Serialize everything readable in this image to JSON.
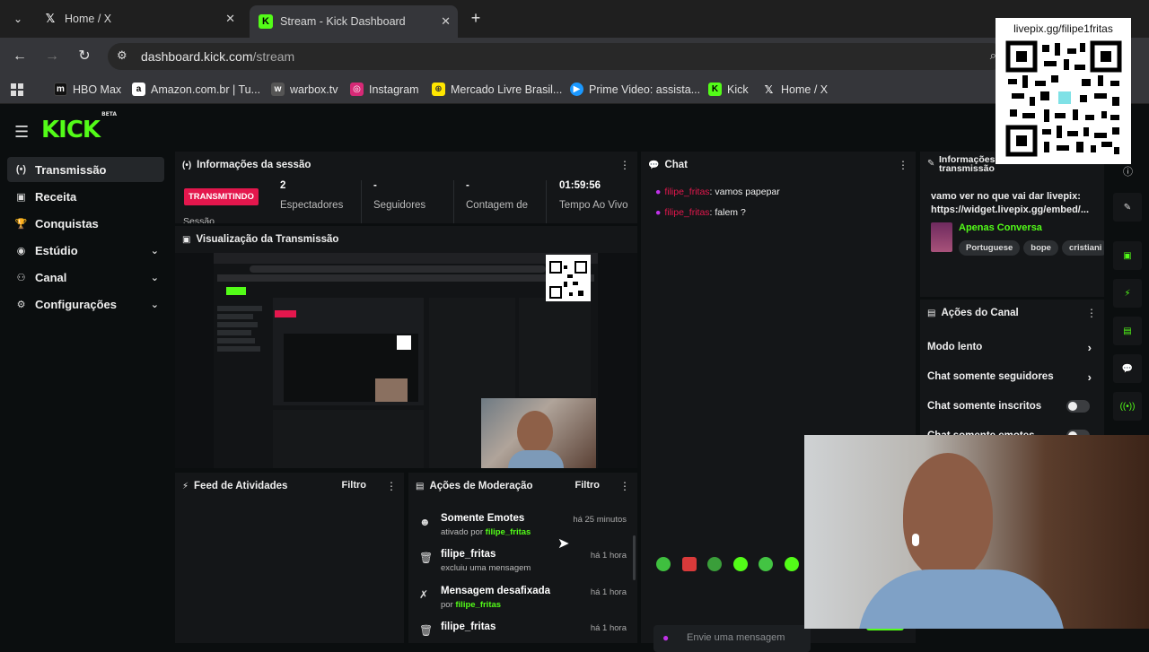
{
  "browser": {
    "tabs": [
      {
        "title": "Home / X",
        "favicon": "x-logo-icon"
      },
      {
        "title": "Stream - Kick Dashboard",
        "favicon": "kick-logo-icon"
      }
    ],
    "new_tab": "+",
    "url_host": "dashboard.kick.com",
    "url_path": "/stream",
    "bookmarks": [
      {
        "label": "HBO Max",
        "icon": "m",
        "color": "#111111"
      },
      {
        "label": "Amazon.com.br | Tu...",
        "icon": "a",
        "color": "#ffffff"
      },
      {
        "label": "warbox.tv",
        "icon": "w",
        "color": "#555555"
      },
      {
        "label": "Instagram",
        "icon": "ig",
        "color": "#d62976"
      },
      {
        "label": "Mercado Livre Brasil...",
        "icon": "ml",
        "color": "#ffe600"
      },
      {
        "label": "Prime Video: assista...",
        "icon": "pv",
        "color": "#1a98ff"
      },
      {
        "label": "Kick",
        "icon": "k",
        "color": "#53fc18"
      },
      {
        "label": "Home / X",
        "icon": "x",
        "color": "#000000"
      }
    ]
  },
  "qr": {
    "caption": "livepix.gg/filipe1fritas"
  },
  "kick": {
    "logo": "KICK",
    "logo_badge": "BETA",
    "sidebar": [
      {
        "label": "Transmissão",
        "icon": "broadcast-icon",
        "active": true
      },
      {
        "label": "Receita",
        "icon": "revenue-icon"
      },
      {
        "label": "Conquistas",
        "icon": "achievements-icon"
      },
      {
        "label": "Estúdio",
        "icon": "studio-icon",
        "chevron": true
      },
      {
        "label": "Canal",
        "icon": "channel-icon",
        "chevron": true
      },
      {
        "label": "Configurações",
        "icon": "settings-icon",
        "chevron": true
      }
    ],
    "session": {
      "title": "Informações da sessão",
      "live_badge": "TRANSMITINDO",
      "session_label": "Sessão",
      "stats": [
        {
          "value": "2",
          "label": "Espectadores"
        },
        {
          "value": "-",
          "label": "Seguidores"
        },
        {
          "value": "-",
          "label": "Contagem de"
        },
        {
          "value": "01:59:56",
          "label": "Tempo Ao Vivo"
        }
      ]
    },
    "preview": {
      "title": "Visualização da Transmissão"
    },
    "activity": {
      "title": "Feed de Atividades",
      "filter": "Filtro"
    },
    "moderation": {
      "title": "Ações de Moderação",
      "filter": "Filtro",
      "rows": [
        {
          "title": "Somente Emotes",
          "sub_prefix": "ativado por ",
          "sub_user": "filipe_fritas",
          "time": "há 25 minutos",
          "icon": "emote-icon"
        },
        {
          "title": "filipe_fritas",
          "sub_prefix": "excluiu uma mensagem",
          "sub_user": "",
          "time": "há 1 hora",
          "icon": "trash-icon"
        },
        {
          "title": "Mensagem desafixada",
          "sub_prefix": "por ",
          "sub_user": "filipe_fritas",
          "time": "há 1 hora",
          "icon": "unpin-icon"
        },
        {
          "title": "filipe_fritas",
          "sub_prefix": "",
          "sub_user": "",
          "time": "há 1 hora",
          "icon": "trash-icon"
        }
      ]
    },
    "chat": {
      "title": "Chat",
      "messages": [
        {
          "user": "filipe_fritas",
          "text": ": vamos papepar"
        },
        {
          "user": "filipe_fritas",
          "text": ": falem ?"
        }
      ],
      "placeholder": "Envie uma mensagem"
    },
    "stream_info": {
      "title_l1": "Informações",
      "title_l2": "transmissão",
      "description": "vamo ver no que vai dar livepix: https://widget.livepix.gg/embed/...",
      "category": "Apenas Conversa",
      "tags": [
        "Portuguese",
        "bope",
        "cristiani"
      ]
    },
    "channel_actions": {
      "title": "Ações do Canal",
      "items": [
        {
          "label": "Modo lento",
          "control": "chevron"
        },
        {
          "label": "Chat somente seguidores",
          "control": "chevron"
        },
        {
          "label": "Chat somente inscritos",
          "control": "toggle"
        },
        {
          "label": "Chat somente emotes",
          "control": "toggle"
        }
      ]
    }
  }
}
